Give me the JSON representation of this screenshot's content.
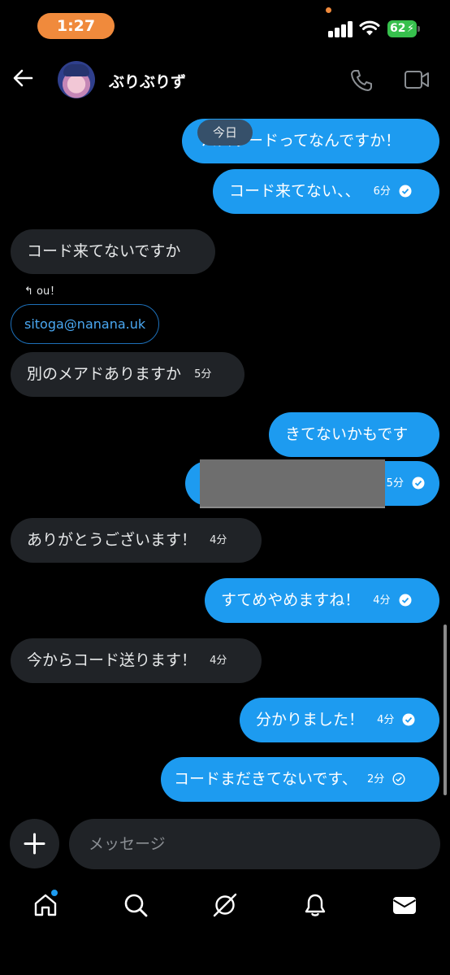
{
  "status_bar": {
    "time": "1:27",
    "battery": "62"
  },
  "header": {
    "contact_name": "ぶりぶりず"
  },
  "date_divider": "今日",
  "messages": [
    {
      "dir": "sent",
      "text": "パスワードってなんですか！",
      "time": ""
    },
    {
      "dir": "sent",
      "text": "コード来てない、、",
      "time": "6分",
      "read": true
    },
    {
      "dir": "recv",
      "text": "コード来てないですか",
      "time": ""
    },
    {
      "dir": "recv",
      "reply_to": "ou！",
      "text": "sitoga@nanana.uk",
      "time": ""
    },
    {
      "dir": "recv",
      "text": "別のメアドありますか",
      "time": "5分"
    },
    {
      "dir": "sent",
      "text": "きてないかもです",
      "time": ""
    },
    {
      "dir": "sent",
      "text": "",
      "time": "5分",
      "redacted": true,
      "read": true
    },
    {
      "dir": "recv",
      "text": "ありがとうございます！",
      "time": "4分"
    },
    {
      "dir": "sent",
      "text": "すてめやめますね！",
      "time": "4分",
      "read": true
    },
    {
      "dir": "recv",
      "text": "今からコード送ります！",
      "time": "4分"
    },
    {
      "dir": "sent",
      "text": "分かりました！",
      "time": "4分",
      "read": true
    },
    {
      "dir": "sent",
      "text": "コードまだきてないです、",
      "time": "2分",
      "read": false
    }
  ],
  "composer": {
    "placeholder": "メッセージ"
  },
  "nav": {
    "items": [
      "home-icon",
      "search-icon",
      "grok-icon",
      "notifications-icon",
      "messages-icon"
    ]
  },
  "colors": {
    "accent": "#1d9bf0",
    "bubble_received": "#202327",
    "background": "#000000",
    "time_pill": "#f08a3c"
  }
}
